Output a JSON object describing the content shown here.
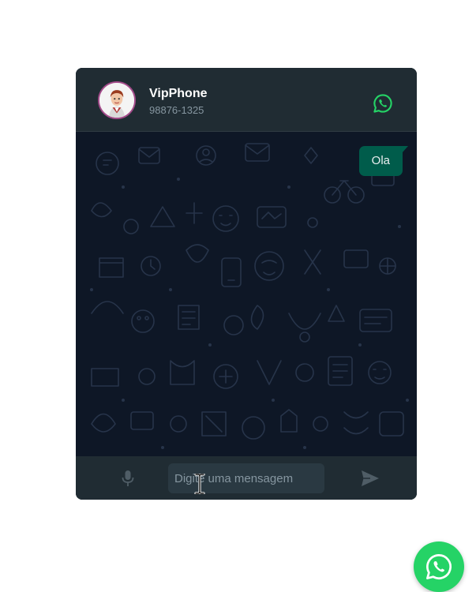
{
  "contact": {
    "name": "VipPhone",
    "phone": "98876-1325"
  },
  "messages": [
    {
      "text": "Ola",
      "direction": "outgoing"
    }
  ],
  "composer": {
    "placeholder": "Digite uma mensagem",
    "value": ""
  },
  "icons": {
    "header": "whatsapp-icon",
    "mic": "microphone-icon",
    "send": "send-icon",
    "floating": "whatsapp-icon",
    "cursor": "text-cursor-icon"
  },
  "colors": {
    "header_bg": "#202c33",
    "chat_bg": "#0e1726",
    "bubble_out": "#005c4b",
    "brand_green": "#25d366",
    "muted_text": "#8696a0"
  }
}
